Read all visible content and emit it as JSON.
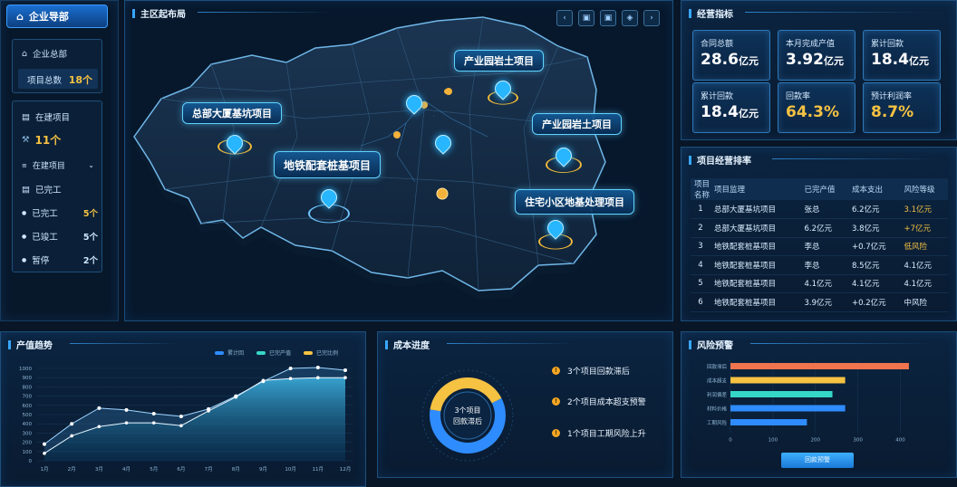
{
  "nav": {
    "title": "企业导部"
  },
  "sidebar": {
    "hq_label": "企业总部",
    "project_total_label": "项目总数",
    "project_total_value": "18个",
    "in_progress_label": "在建项目",
    "in_progress_value": "11个",
    "dropdown_value": "在建项目",
    "completed_label": "已完工",
    "items": [
      {
        "label": "已完工",
        "value": "5个"
      },
      {
        "label": "已竣工",
        "value": "5个"
      },
      {
        "label": "暂停",
        "value": "2个"
      }
    ]
  },
  "map": {
    "title": "主区起布局",
    "labels": [
      "产业园岩土项目",
      "总部大厦基坑项目",
      "产业园岩土项目",
      "地铁配套桩基项目",
      "住宅小区地基处理项目"
    ],
    "toolbar": [
      "‹",
      "▣",
      "▣",
      "◈",
      "›"
    ]
  },
  "kpi": {
    "title": "经营指标",
    "cards": [
      {
        "label": "合同总额",
        "value": "28.6",
        "unit": "亿元",
        "color": "#ffffff"
      },
      {
        "label": "本月完成产值",
        "value": "3.92",
        "unit": "亿元",
        "color": "#ffffff"
      },
      {
        "label": "累计回款",
        "value": "18.4",
        "unit": "亿元",
        "color": "#ffffff"
      },
      {
        "label": "累计回款",
        "value": "18.4",
        "unit": "亿元",
        "color": "#ffffff"
      },
      {
        "label": "回款率",
        "value": "64.3%",
        "unit": "",
        "color": "#f5c242"
      },
      {
        "label": "预计利润率",
        "value": "8.7%",
        "unit": "",
        "color": "#f5c242"
      }
    ]
  },
  "ranking": {
    "title": "项目经营排率",
    "headers": [
      "项目名称",
      "项目监理",
      "已完产值",
      "成本支出",
      "风险等级"
    ],
    "rows": [
      [
        "1",
        "总部大厦基坑项目",
        "张总",
        "6.2亿元",
        "3.1亿元"
      ],
      [
        "2",
        "总部大厦基坑项目",
        "6.2亿元",
        "3.8亿元",
        "+7亿元"
      ],
      [
        "3",
        "地铁配套桩基项目",
        "李总",
        "+0.7亿元",
        "低风险"
      ],
      [
        "4",
        "地铁配套桩基项目",
        "李总",
        "8.5亿元",
        "4.1亿元"
      ],
      [
        "5",
        "地铁配套桩基项目",
        "4.1亿元",
        "4.1亿元",
        "4.1亿元"
      ],
      [
        "6",
        "地铁配套桩基项目",
        "3.9亿元",
        "+0.2亿元",
        "中风险"
      ]
    ],
    "highlight_color": "#f5c242"
  },
  "trend": {
    "title": "产值趋势",
    "legend": [
      "累计回",
      "已完产值",
      "已完比例"
    ],
    "legend_colors": [
      "#2f8cff",
      "#35d7c7",
      "#f5c242"
    ]
  },
  "cost": {
    "title": "成本进度",
    "center_text": [
      "3个项目",
      "回款滞后"
    ],
    "items": [
      "3个项目回款滞后",
      "2个项目成本超支预警",
      "1个项目工期风险上升"
    ]
  },
  "risk": {
    "title": "风险预警",
    "button_label": "回款预警"
  },
  "chart_data": [
    {
      "type": "area",
      "title": "产值趋势",
      "x": [
        "1月",
        "2月",
        "3月",
        "4月",
        "5月",
        "6月",
        "7月",
        "8月",
        "9月",
        "10月",
        "11月",
        "12月"
      ],
      "ylim": [
        0,
        1000
      ],
      "yticks": [
        0,
        100,
        200,
        300,
        400,
        500,
        600,
        700,
        800,
        900,
        1000
      ],
      "series": [
        {
          "name": "累计回",
          "values": [
            180,
            400,
            570,
            550,
            510,
            480,
            560,
            700,
            860,
            1000,
            1010,
            980
          ]
        },
        {
          "name": "已完产值",
          "values": [
            80,
            270,
            370,
            410,
            410,
            380,
            540,
            690,
            870,
            890,
            900,
            900
          ]
        }
      ]
    },
    {
      "type": "pie",
      "title": "成本进度",
      "values": [
        60,
        40
      ],
      "colors": [
        "#2f8cff",
        "#f5c242"
      ]
    },
    {
      "type": "bar",
      "title": "风险预警",
      "orientation": "horizontal",
      "categories": [
        "回款滞后",
        "成本超支",
        "利润偏差",
        "材料价格",
        "工期风险"
      ],
      "values": [
        420,
        270,
        240,
        270,
        180
      ],
      "colors": [
        "#f0744e",
        "#f5c242",
        "#35d7c7",
        "#2f8cff",
        "#2f8cff"
      ],
      "xticks": [
        0,
        100,
        200,
        300,
        400
      ],
      "xlim": [
        0,
        450
      ]
    }
  ]
}
